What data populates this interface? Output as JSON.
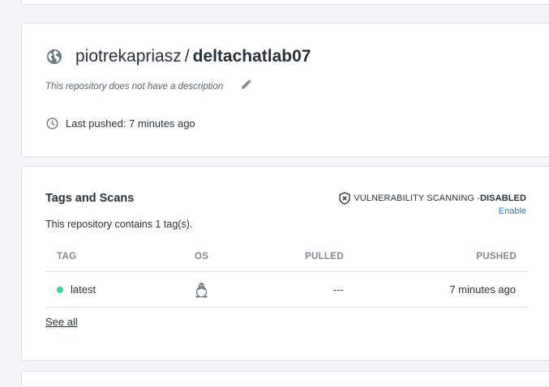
{
  "repo": {
    "owner": "piotrekapriasz",
    "separator": "/",
    "name": "deltachatlab07",
    "description": "This repository does not have a description",
    "last_pushed": "Last pushed: 7 minutes ago",
    "visibility_icon": "globe-icon"
  },
  "tags_section": {
    "title": "Tags and Scans",
    "vulnerability_label": "VULNERABILITY SCANNING - ",
    "vulnerability_status": "DISABLED",
    "enable_label": "Enable",
    "count_text": "This repository contains 1 tag(s).",
    "columns": {
      "tag": "TAG",
      "os": "OS",
      "pulled": "PULLED",
      "pushed": "PUSHED"
    },
    "rows": [
      {
        "tag": "latest",
        "os": "linux-icon",
        "pulled": "---",
        "pushed": "7 minutes ago",
        "status_color": "#3ecfa1"
      }
    ],
    "see_all_label": "See all"
  },
  "colors": {
    "background": "#f2f4f6",
    "text": "#27323a",
    "muted": "#7d8a94",
    "link": "#1f7bd1",
    "status_active": "#3ecfa1"
  }
}
